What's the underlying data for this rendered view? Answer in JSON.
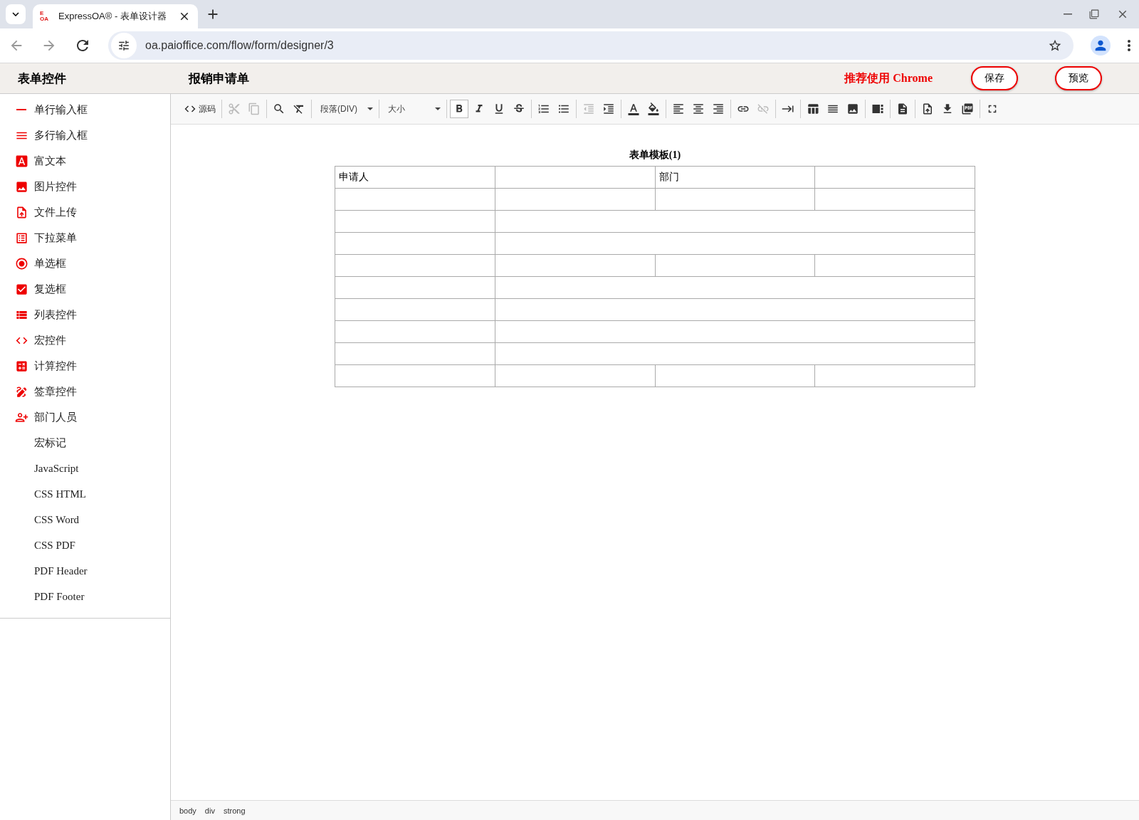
{
  "browser": {
    "favicon": [
      "E",
      "OA"
    ],
    "tab_title": "ExpressOA® - 表单设计器",
    "url": "oa.paioffice.com/flow/form/designer/3"
  },
  "header": {
    "sidebar_title": "表单控件",
    "form_title": "报销申请单",
    "notice": "推荐使用 Chrome",
    "buttons": [
      "保存",
      "预览"
    ]
  },
  "sidebar": {
    "items": [
      {
        "kind": "control",
        "label": "单行输入框"
      },
      {
        "kind": "control",
        "label": "多行输入框"
      },
      {
        "kind": "control",
        "label": "富文本"
      },
      {
        "kind": "control",
        "label": "图片控件"
      },
      {
        "kind": "control",
        "label": "文件上传"
      },
      {
        "kind": "control",
        "label": "下拉菜单"
      },
      {
        "kind": "control",
        "label": "单选框"
      },
      {
        "kind": "control",
        "label": "复选框"
      },
      {
        "kind": "control",
        "label": "列表控件"
      },
      {
        "kind": "control",
        "label": "宏控件"
      },
      {
        "kind": "control",
        "label": "计算控件"
      },
      {
        "kind": "control",
        "label": "签章控件"
      },
      {
        "kind": "control",
        "label": "部门人员"
      },
      {
        "kind": "code",
        "label": "宏标记"
      },
      {
        "kind": "code",
        "label": "JavaScript"
      },
      {
        "kind": "code",
        "label": "CSS HTML"
      },
      {
        "kind": "code",
        "label": "CSS Word"
      },
      {
        "kind": "code",
        "label": "CSS PDF"
      },
      {
        "kind": "code",
        "label": "PDF Header"
      },
      {
        "kind": "code",
        "label": "PDF Footer"
      }
    ]
  },
  "toolbar": {
    "groups": [
      [
        {
          "kind": "button",
          "label": "源码",
          "disabled": false,
          "selected": false
        }
      ],
      [
        {
          "kind": "button",
          "disabled": true,
          "selected": false
        },
        {
          "kind": "button",
          "disabled": true,
          "selected": false
        }
      ],
      [
        {
          "kind": "button",
          "disabled": false,
          "selected": false
        },
        {
          "kind": "button",
          "disabled": false,
          "selected": false
        }
      ],
      [
        {
          "kind": "dropdown",
          "label": "段落(DIV)"
        }
      ],
      [
        {
          "kind": "dropdown",
          "label": "大小"
        }
      ],
      [
        {
          "kind": "button",
          "disabled": false,
          "selected": true
        },
        {
          "kind": "button",
          "disabled": false,
          "selected": false
        },
        {
          "kind": "button",
          "disabled": false,
          "selected": false
        },
        {
          "kind": "button",
          "disabled": false,
          "selected": false
        }
      ],
      [
        {
          "kind": "button",
          "disabled": false,
          "selected": false
        },
        {
          "kind": "button",
          "disabled": false,
          "selected": false
        }
      ],
      [
        {
          "kind": "button",
          "disabled": true,
          "selected": false
        },
        {
          "kind": "button",
          "disabled": false,
          "selected": false
        }
      ],
      [
        {
          "kind": "button",
          "disabled": false,
          "selected": false
        },
        {
          "kind": "button",
          "disabled": false,
          "selected": false
        }
      ],
      [
        {
          "kind": "button",
          "disabled": false,
          "selected": false
        },
        {
          "kind": "button",
          "disabled": false,
          "selected": false
        },
        {
          "kind": "button",
          "disabled": false,
          "selected": false
        }
      ],
      [
        {
          "kind": "button",
          "disabled": false,
          "selected": false
        },
        {
          "kind": "button",
          "disabled": true,
          "selected": false
        }
      ],
      [
        {
          "kind": "button",
          "disabled": false,
          "selected": false
        }
      ],
      [
        {
          "kind": "button",
          "disabled": false,
          "selected": false
        },
        {
          "kind": "button",
          "disabled": false,
          "selected": false
        },
        {
          "kind": "button",
          "disabled": false,
          "selected": false
        }
      ],
      [
        {
          "kind": "button",
          "disabled": false,
          "selected": false
        }
      ],
      [
        {
          "kind": "button",
          "disabled": false,
          "selected": false
        }
      ],
      [
        {
          "kind": "button",
          "disabled": false,
          "selected": false
        },
        {
          "kind": "button",
          "disabled": false,
          "selected": false
        },
        {
          "kind": "button",
          "disabled": false,
          "selected": false
        }
      ],
      [
        {
          "kind": "button",
          "disabled": false,
          "selected": false
        }
      ]
    ]
  },
  "document": {
    "title": "表单模板(1)",
    "rows": [
      {
        "kind": "split",
        "label_1": "申请人",
        "label_3": "部门"
      },
      {
        "kind": "split"
      },
      {
        "kind": "merged"
      },
      {
        "kind": "merged"
      },
      {
        "kind": "split"
      },
      {
        "kind": "merged"
      },
      {
        "kind": "merged"
      },
      {
        "kind": "merged"
      },
      {
        "kind": "merged"
      },
      {
        "kind": "split"
      }
    ]
  },
  "status_bar": {
    "path": [
      "body",
      "div",
      "strong"
    ]
  }
}
